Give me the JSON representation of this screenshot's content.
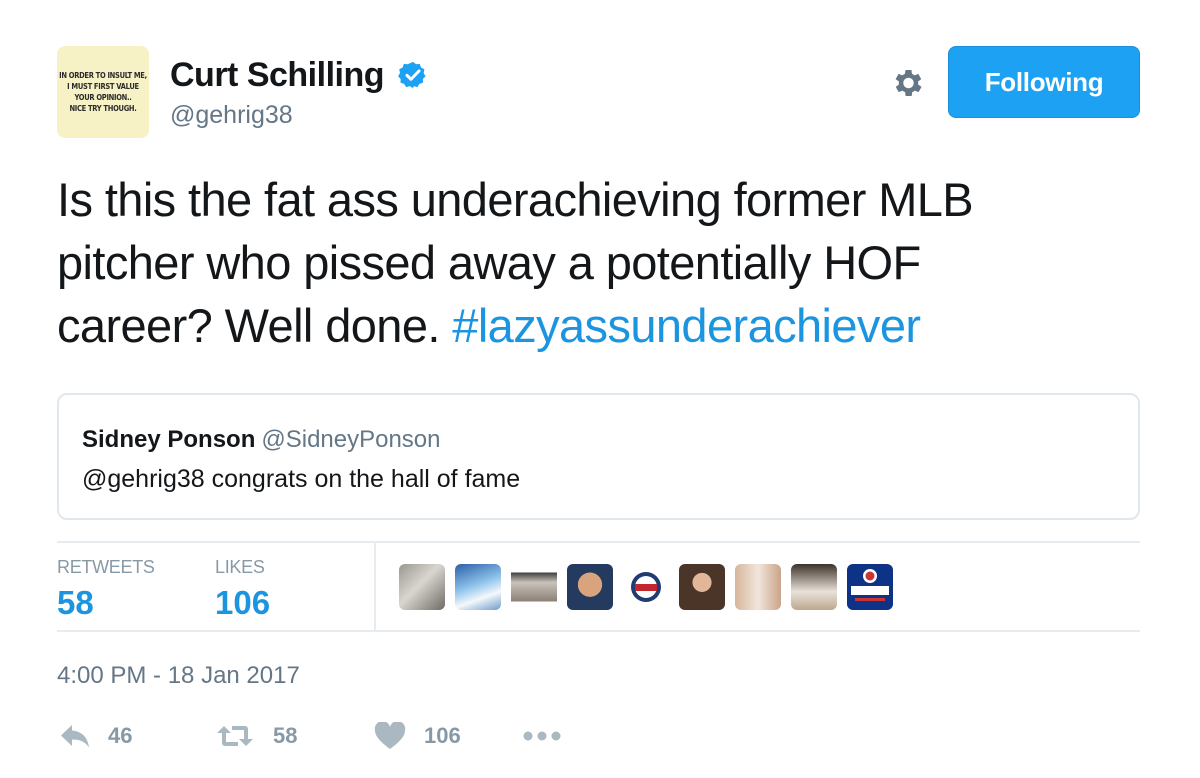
{
  "profile": {
    "avatar_text": [
      "IN ORDER TO INSULT ME,",
      "I MUST FIRST VALUE",
      "YOUR OPINION..",
      "NICE TRY THOUGH."
    ],
    "name": "Curt Schilling",
    "handle": "@gehrig38",
    "verified_icon": "verified-badge-icon"
  },
  "header": {
    "settings_icon": "gear-icon",
    "follow_label": "Following"
  },
  "tweet": {
    "lines": [
      "Is this the fat ass underachieving former MLB",
      "pitcher who pissed away a potentially HOF",
      "career? Well done. "
    ],
    "hashtag": "#lazyassunderachiever"
  },
  "quoted_tweet": {
    "name": "Sidney Ponson",
    "handle": "@SidneyPonson",
    "text": "@gehrig38 congrats on the hall of fame"
  },
  "stats": {
    "retweets_label": "RETWEETS",
    "retweets_value": "58",
    "likes_label": "LIKES",
    "likes_value": "106"
  },
  "likers": [
    "liker-avatar-1",
    "liker-avatar-2",
    "liker-avatar-3",
    "liker-avatar-4",
    "liker-avatar-5",
    "liker-avatar-6",
    "liker-avatar-7",
    "liker-avatar-8",
    "liker-avatar-9"
  ],
  "timestamp": "4:00 PM - 18 Jan 2017",
  "actions": {
    "reply_count": "46",
    "retweet_count": "58",
    "like_count": "106",
    "more_icon": "more-icon"
  },
  "colors": {
    "accent": "#1da1f2",
    "link": "#1b95e0",
    "muted": "#657786"
  }
}
